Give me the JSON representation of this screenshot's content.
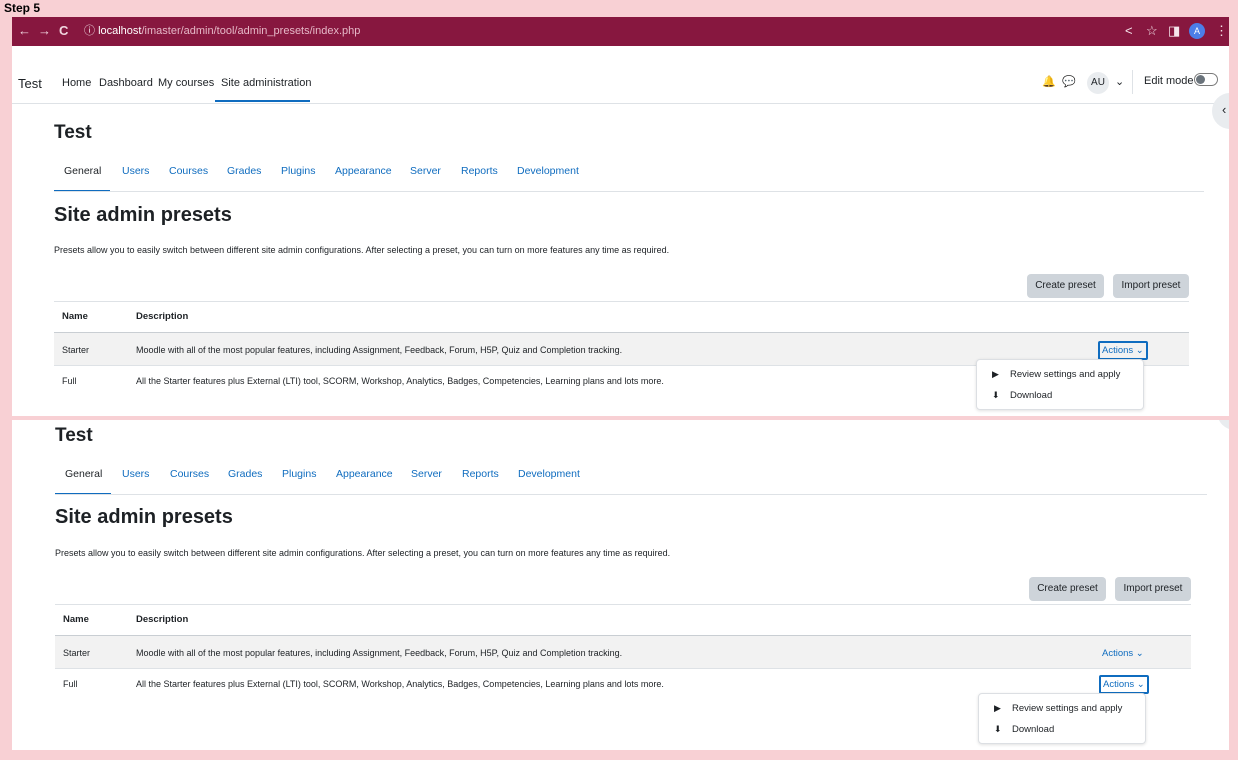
{
  "step_label": "Step 5",
  "browser": {
    "back_icon": "←",
    "forward_icon": "→",
    "reload_icon": "C",
    "info_icon": "ⓘ",
    "url_host": "localhost",
    "url_path": "/imaster/admin/tool/admin_presets/index.php",
    "share_icon": "<",
    "star_icon": "☆",
    "sidepanel_icon": "◨",
    "profile_initial": "A",
    "menu_icon": "⋮"
  },
  "nav": {
    "brand": "Test",
    "items": [
      "Home",
      "Dashboard",
      "My courses",
      "Site administration"
    ],
    "bell_icon": "🔔",
    "chat_icon": "💬",
    "avatar": "AU",
    "avatar_caret": "⌄",
    "edit_mode_label": "Edit mode",
    "drawer_icon": "‹"
  },
  "page": {
    "title": "Test",
    "tabs": [
      "General",
      "Users",
      "Courses",
      "Grades",
      "Plugins",
      "Appearance",
      "Server",
      "Reports",
      "Development"
    ],
    "heading": "Site admin presets",
    "intro": "Presets allow you to easily switch between different site admin configurations. After selecting a preset, you can turn on more features any time as required.",
    "create_button": "Create preset",
    "import_button": "Import preset",
    "table": {
      "headers": [
        "Name",
        "Description"
      ],
      "rows": [
        {
          "name": "Starter",
          "description": "Moodle with all of the most popular features, including Assignment, Feedback, Forum, H5P, Quiz and Completion tracking.",
          "actions": "Actions ⌄"
        },
        {
          "name": "Full",
          "description": "All the Starter features plus External (LTI) tool, SCORM, Workshop, Analytics, Badges, Competencies, Learning plans and lots more.",
          "actions": "Actions ⌄"
        }
      ]
    },
    "menu": {
      "review_icon": "▶",
      "review": "Review settings and apply",
      "download_icon": "⬇",
      "download": "Download"
    }
  }
}
